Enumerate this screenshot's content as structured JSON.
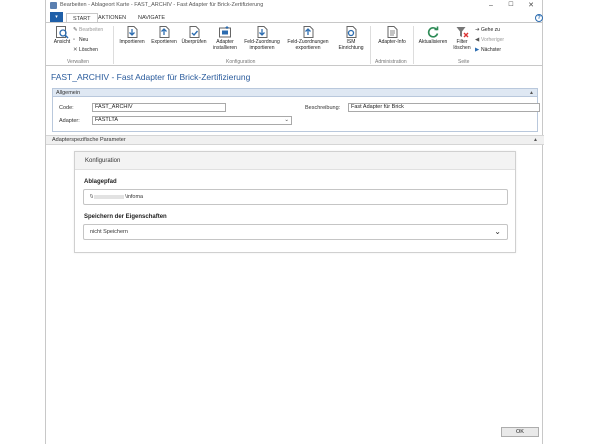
{
  "window": {
    "title": "Bearbeiten - Ablageort Karte - FAST_ARCHIV - Fast Adapter für Brick-Zertifizierung"
  },
  "tabs": [
    "START",
    "AKTIONEN",
    "NAVIGATE"
  ],
  "ribbon": {
    "verwalten": {
      "label": "Verwalten",
      "ansicht": "Ansicht",
      "bearbeiten": "Bearbeiten",
      "neu": "Neu",
      "loeschen": "Löschen"
    },
    "konfiguration": {
      "label": "Konfiguration",
      "importieren": "Importieren",
      "exportieren": "Exportieren",
      "ueberpruefen": "Überprüfen",
      "adapter_installieren": [
        "Adapter",
        "installieren"
      ],
      "feld_zuordnung_importieren": [
        "Feld-Zuordnung",
        "importieren"
      ],
      "feld_zuordnungen_exportieren": [
        "Feld-Zuordnungen",
        "exportieren"
      ],
      "ism_einrichtung": [
        "ISM",
        "Einrichtung"
      ]
    },
    "administration": {
      "label": "Administration",
      "adapter_info": "Adapter-Info"
    },
    "seite": {
      "label": "Seite",
      "aktualisieren": "Aktualisieren",
      "filter_loeschen": [
        "Filter",
        "löschen"
      ],
      "gehe_zu": "Gehe zu",
      "vorheriger": "Vorheriger",
      "naechster": "Nächster"
    }
  },
  "page_title": "FAST_ARCHIV - Fast Adapter für Brick-Zertifizierung",
  "allgemein": {
    "header": "Allgemein",
    "code_label": "Code:",
    "code_value": "FAST_ARCHIV",
    "adapter_label": "Adapter:",
    "adapter_value": "FASTLTA",
    "beschreibung_label": "Beschreibung:",
    "beschreibung_value": "Fast Adapter für Brick"
  },
  "adapter_params": {
    "header": "Adapterspezifische Parameter"
  },
  "konfiguration": {
    "header": "Konfiguration",
    "ablagepfad_label": "Ablagepfad",
    "ablagepfad_prefix": "\\\\",
    "ablagepfad_suffix": "\\infoma",
    "speichern_label": "Speichern der Eigenschaften",
    "speichern_value": "nicht Speichern"
  },
  "ok_button": "OK"
}
